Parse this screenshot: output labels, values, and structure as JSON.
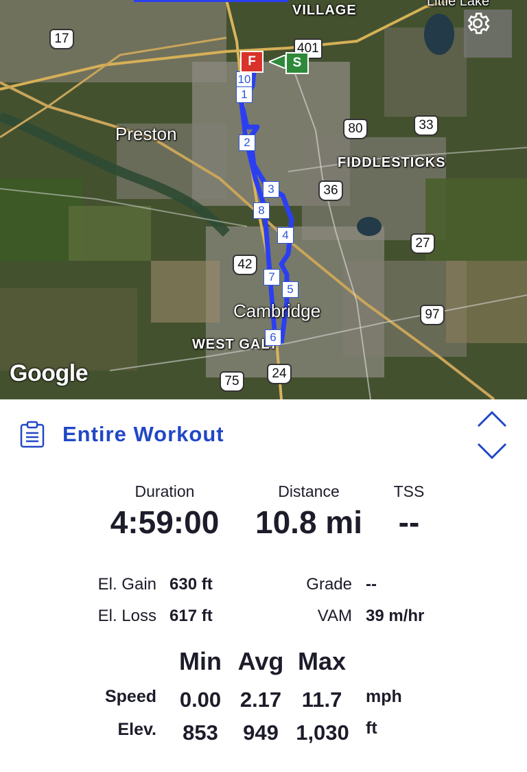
{
  "map": {
    "labels": {
      "village": "VILLAGE",
      "little_lake": "Little Lake",
      "preston": "Preston",
      "fiddlesticks": "FIDDLESTICKS",
      "cambridge": "Cambridge",
      "west_galt": "WEST GALT"
    },
    "shields": {
      "r17": "17",
      "r401": "401",
      "r80": "80",
      "r33": "33",
      "r36": "36",
      "r27": "27",
      "r42": "42",
      "r97": "97",
      "r75": "75",
      "r24": "24"
    },
    "waypoints": {
      "w1": "1",
      "w2": "2",
      "w3": "3",
      "w4": "4",
      "w5": "5",
      "w6": "6",
      "w7": "7",
      "w8": "8",
      "w10": "10"
    },
    "finish_flag": "F",
    "start_flag": "S",
    "attribution": "Google",
    "route_color": "#2b3ff0",
    "settings_icon": "gear-icon"
  },
  "workout": {
    "title": "Entire Workout",
    "icon": "clipboard-icon",
    "accent": "#2147c6",
    "duration": {
      "label": "Duration",
      "value": "4:59:00"
    },
    "distance": {
      "label": "Distance",
      "value": "10.8 mi"
    },
    "tss": {
      "label": "TSS",
      "value": "--"
    },
    "el_gain": {
      "label": "El. Gain",
      "value": "630 ft"
    },
    "el_loss": {
      "label": "El. Loss",
      "value": "617 ft"
    },
    "grade": {
      "label": "Grade",
      "value": "--"
    },
    "vam": {
      "label": "VAM",
      "value": "39 m/hr"
    },
    "columns": [
      "Min",
      "Avg",
      "Max"
    ],
    "speed": {
      "label": "Speed",
      "min": "0.00",
      "avg": "2.17",
      "max": "11.7",
      "unit": "mph"
    },
    "elev": {
      "label": "Elev.",
      "min": "853",
      "avg": "949",
      "max": "1,030",
      "unit": "ft"
    }
  }
}
